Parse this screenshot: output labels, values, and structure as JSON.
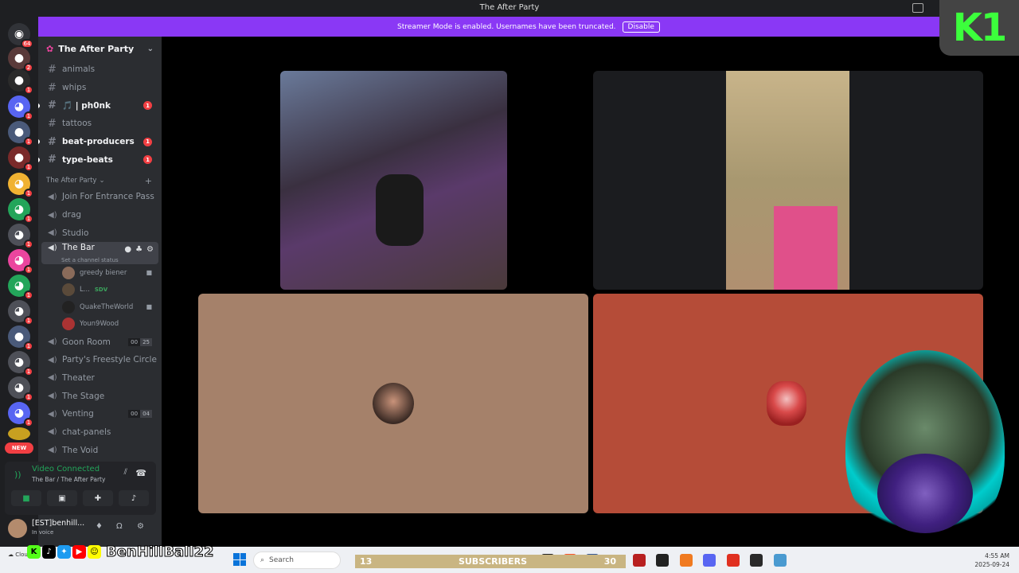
{
  "window": {
    "title": "The After Party"
  },
  "streamer_banner": {
    "text": "Streamer Mode is enabled. Usernames have been truncated.",
    "button": "Disable"
  },
  "overlay": {
    "logo_text": "K1"
  },
  "server_rail": {
    "top_badge": "64",
    "badges": [
      "2",
      "1",
      "1",
      "1",
      "1",
      "1",
      "1",
      "1",
      "1",
      "1",
      "1",
      "1",
      "1",
      "1",
      "1"
    ],
    "new_label": "NEW"
  },
  "guild": {
    "name": "The After Party"
  },
  "text_channels": [
    {
      "name": "animals",
      "unread": false,
      "mention": ""
    },
    {
      "name": "whips",
      "unread": false,
      "mention": ""
    },
    {
      "name": "🎵 | ph0nk",
      "unread": true,
      "mention": "1"
    },
    {
      "name": "tattoos",
      "unread": false,
      "mention": ""
    },
    {
      "name": "beat-producers",
      "unread": true,
      "mention": "1"
    },
    {
      "name": "type-beats",
      "unread": true,
      "mention": "1"
    }
  ],
  "category": {
    "name": "The After Party"
  },
  "voice_channels_top": [
    {
      "name": "Join For Entrance Pass"
    },
    {
      "name": "drag"
    },
    {
      "name": "Studio"
    }
  ],
  "active_channel": {
    "name": "The Bar",
    "status": "Set a channel status"
  },
  "voice_users": [
    {
      "name": "greedy biener",
      "tag": "",
      "camera": true
    },
    {
      "name": "L...",
      "tag": "SDV",
      "camera": false
    },
    {
      "name": "QuakeTheWorld",
      "tag": "",
      "camera": true
    },
    {
      "name": "Youn9Wood",
      "tag": "",
      "camera": false
    }
  ],
  "voice_channels_bottom": [
    {
      "name": "Goon Room",
      "count_a": "00",
      "count_b": "25"
    },
    {
      "name": "Party's Freestyle Circle",
      "count_a": "",
      "count_b": ""
    },
    {
      "name": "Theater",
      "count_a": "",
      "count_b": ""
    },
    {
      "name": "The Stage",
      "count_a": "",
      "count_b": ""
    },
    {
      "name": "Venting",
      "count_a": "00",
      "count_b": "04"
    },
    {
      "name": "chat-panels",
      "count_a": "",
      "count_b": ""
    },
    {
      "name": "The Void",
      "count_a": "",
      "count_b": ""
    }
  ],
  "voice_panel": {
    "status": "Video Connected",
    "location": "The Bar / The After Party"
  },
  "account": {
    "name": "[EST]benhill...",
    "status": "In voice"
  },
  "stream_overlay": {
    "handle": "BenHillBall22",
    "subs_left": "13",
    "subs_label": "SUBSCRIBERS",
    "subs_right": "30"
  },
  "taskbar": {
    "weather": "Cloudy",
    "search_placeholder": "Search",
    "time": "4:55 AM",
    "date": "2025-09-24"
  },
  "colors": {
    "banner": "#8a38f5",
    "tile_left": "#a5816a",
    "tile_right": "#b54c38",
    "mention": "#f23f43",
    "connected": "#23a55a"
  }
}
